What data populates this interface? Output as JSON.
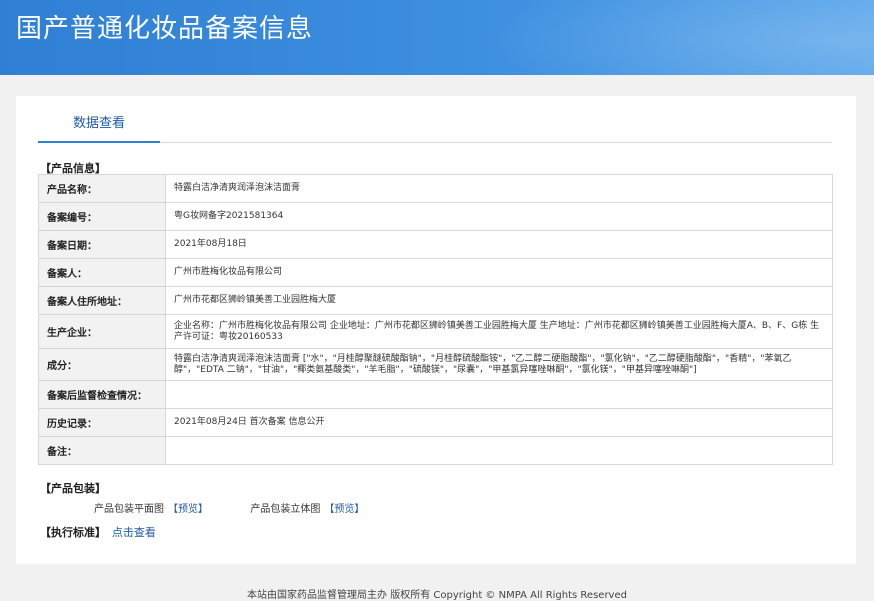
{
  "header": {
    "title": "国产普通化妆品备案信息"
  },
  "tabs": [
    {
      "label": "数据查看"
    }
  ],
  "sections": {
    "product_info": "【产品信息】",
    "packaging": "【产品包装】",
    "standard": "【执行标准】"
  },
  "rows": [
    {
      "label": "产品名称：",
      "value": "特露白洁净清爽润泽泡沫洁面膏"
    },
    {
      "label": "备案编号：",
      "value": "粤G妆网备字2021581364"
    },
    {
      "label": "备案日期：",
      "value": "2021年08月18日"
    },
    {
      "label": "备案人：",
      "value": "广州市胜梅化妆品有限公司"
    },
    {
      "label": "备案人住所地址：",
      "value": "广州市花都区狮岭镇美善工业园胜梅大厦"
    },
    {
      "label": "生产企业：",
      "value": "企业名称：广州市胜梅化妆品有限公司 企业地址：广州市花都区狮岭镇美善工业园胜梅大厦 生产地址：广州市花都区狮岭镇美善工业园胜梅大厦A、B、F、G栋 生产许可证：粤妆20160533"
    },
    {
      "label": "成分：",
      "value": "特露白洁净清爽润泽泡沫洁面膏 [\"水\"，\"月桂醇聚醚硫酸酯钠\"，\"月桂醇硫酸酯铵\"，\"乙二醇二硬脂酸酯\"，\"氯化钠\"，\"乙二醇硬脂酸酯\"，\"香精\"，\"苯氧乙醇\"，\"EDTA 二钠\"，\"甘油\"，\"椰类氨基酸类\"，\"羊毛脂\"，\"硫酸镁\"，\"尿囊\"，\"甲基氯异噻唑啉酮\"，\"氯化镁\"，\"甲基异噻唑啉酮\"]"
    },
    {
      "label": "备案后监督检查情况：",
      "value": ""
    },
    {
      "label": "历史记录：",
      "value": "2021年08月24日 首次备案 信息公开"
    },
    {
      "label": "备注：",
      "value": ""
    }
  ],
  "packaging": {
    "flat_label": "产品包装平面图",
    "flat_link": "【预览】",
    "stereo_label": "产品包装立体图",
    "stereo_link": "【预览】"
  },
  "standard": {
    "link": "点击查看"
  },
  "footer": {
    "text": "本站由国家药品监督管理局主办 版权所有 Copyright © NMPA All Rights Reserved"
  }
}
